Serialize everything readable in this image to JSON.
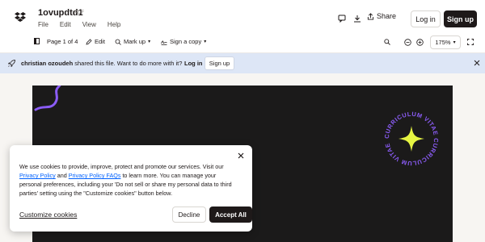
{
  "header": {
    "file_name": "1ovupdtd1",
    "file_type": "PDF",
    "menu": [
      "File",
      "Edit",
      "View",
      "Help"
    ],
    "share_label": "Share",
    "login_label": "Log in",
    "signup_label": "Sign up"
  },
  "toolbar": {
    "page_indicator": "Page 1 of 4",
    "edit_label": "Edit",
    "markup_label": "Mark up",
    "sign_label": "Sign a copy",
    "zoom_level": "175%"
  },
  "banner": {
    "user": "christian ozoudeh",
    "message": "shared this file. Want to do more with it?",
    "login_label": "Log in",
    "signup_label": "Sign up"
  },
  "document": {
    "seal_text": "CURRICULUM VITAE CURRICULUM VITAE",
    "accent_color": "#8b5cf6",
    "star_color": "#e6f542"
  },
  "cookie": {
    "text_1": "We use cookies to provide, improve, protect and promote our services. Visit our",
    "privacy_link": "Privacy Policy",
    "text_and": "and",
    "faq_link": "Privacy Policy FAQs",
    "text_2": "to learn more. You can manage your personal preferences, including your 'Do not sell or share my personal data to third parties' setting using the \"Customize cookies\" button below.",
    "customize_label": "Customize cookies",
    "decline_label": "Decline",
    "accept_label": "Accept All"
  },
  "colors": {
    "primary_dark": "#1e1919",
    "banner_bg": "#dde6f6",
    "link": "#0061fe"
  }
}
